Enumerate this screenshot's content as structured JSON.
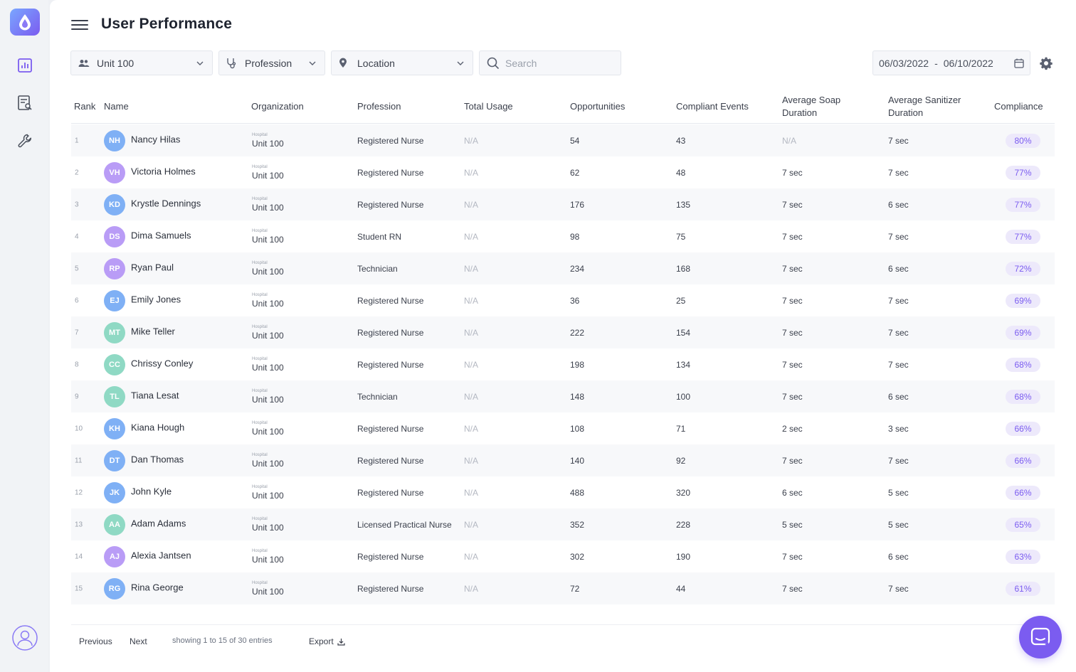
{
  "page": {
    "title": "User Performance"
  },
  "filters": {
    "unit": "Unit 100",
    "profession": "Profession",
    "location": "Location",
    "search_placeholder": "Search",
    "date_start": "06/03/2022",
    "date_sep": "-",
    "date_end": "06/10/2022"
  },
  "columns": {
    "rank": "Rank",
    "name": "Name",
    "organization": "Organization",
    "profession": "Profession",
    "total_usage": "Total Usage",
    "opportunities": "Opportunities",
    "compliant_events": "Compliant Events",
    "avg_soap_1": "Average Soap",
    "avg_soap_2": "Duration",
    "avg_sanitizer_1": "Average Sanitizer",
    "avg_sanitizer_2": "Duration",
    "compliance": "Compliance"
  },
  "rows": [
    {
      "rank": "1",
      "initials": "NH",
      "color": "#7fb0f5",
      "name": "Nancy Hilas",
      "org_label": "Hospital",
      "org": "Unit 100",
      "profession": "Registered Nurse",
      "usage": "N/A",
      "opportunities": "54",
      "compliant": "43",
      "soap": "N/A",
      "sanitizer": "7 sec",
      "compliance": "80%"
    },
    {
      "rank": "2",
      "initials": "VH",
      "color": "#b99cf6",
      "name": "Victoria Holmes",
      "org_label": "Hospital",
      "org": "Unit 100",
      "profession": "Registered Nurse",
      "usage": "N/A",
      "opportunities": "62",
      "compliant": "48",
      "soap": "7 sec",
      "sanitizer": "7 sec",
      "compliance": "77%"
    },
    {
      "rank": "3",
      "initials": "KD",
      "color": "#7fb0f5",
      "name": "Krystle Dennings",
      "org_label": "Hospital",
      "org": "Unit 100",
      "profession": "Registered Nurse",
      "usage": "N/A",
      "opportunities": "176",
      "compliant": "135",
      "soap": "7 sec",
      "sanitizer": "6 sec",
      "compliance": "77%"
    },
    {
      "rank": "4",
      "initials": "DS",
      "color": "#b99cf6",
      "name": "Dima Samuels",
      "org_label": "Hospital",
      "org": "Unit 100",
      "profession": "Student RN",
      "usage": "N/A",
      "opportunities": "98",
      "compliant": "75",
      "soap": "7 sec",
      "sanitizer": "7 sec",
      "compliance": "77%"
    },
    {
      "rank": "5",
      "initials": "RP",
      "color": "#b99cf6",
      "name": "Ryan Paul",
      "org_label": "Hospital",
      "org": "Unit 100",
      "profession": "Technician",
      "usage": "N/A",
      "opportunities": "234",
      "compliant": "168",
      "soap": "7 sec",
      "sanitizer": "6 sec",
      "compliance": "72%"
    },
    {
      "rank": "6",
      "initials": "EJ",
      "color": "#7fb0f5",
      "name": "Emily Jones",
      "org_label": "Hospital",
      "org": "Unit 100",
      "profession": "Registered Nurse",
      "usage": "N/A",
      "opportunities": "36",
      "compliant": "25",
      "soap": "7 sec",
      "sanitizer": "7 sec",
      "compliance": "69%"
    },
    {
      "rank": "7",
      "initials": "MT",
      "color": "#8fd9c4",
      "name": "Mike Teller",
      "org_label": "Hospital",
      "org": "Unit 100",
      "profession": "Registered Nurse",
      "usage": "N/A",
      "opportunities": "222",
      "compliant": "154",
      "soap": "7 sec",
      "sanitizer": "7 sec",
      "compliance": "69%"
    },
    {
      "rank": "8",
      "initials": "CC",
      "color": "#8fd9c4",
      "name": "Chrissy Conley",
      "org_label": "Hospital",
      "org": "Unit 100",
      "profession": "Registered Nurse",
      "usage": "N/A",
      "opportunities": "198",
      "compliant": "134",
      "soap": "7 sec",
      "sanitizer": "7 sec",
      "compliance": "68%"
    },
    {
      "rank": "9",
      "initials": "TL",
      "color": "#8fd9c4",
      "name": "Tiana Lesat",
      "org_label": "Hospital",
      "org": "Unit 100",
      "profession": "Technician",
      "usage": "N/A",
      "opportunities": "148",
      "compliant": "100",
      "soap": "7 sec",
      "sanitizer": "6 sec",
      "compliance": "68%"
    },
    {
      "rank": "10",
      "initials": "KH",
      "color": "#7fb0f5",
      "name": "Kiana Hough",
      "org_label": "Hospital",
      "org": "Unit 100",
      "profession": "Registered Nurse",
      "usage": "N/A",
      "opportunities": "108",
      "compliant": "71",
      "soap": "2 sec",
      "sanitizer": "3 sec",
      "compliance": "66%"
    },
    {
      "rank": "11",
      "initials": "DT",
      "color": "#7fb0f5",
      "name": "Dan Thomas",
      "org_label": "Hospital",
      "org": "Unit 100",
      "profession": "Registered Nurse",
      "usage": "N/A",
      "opportunities": "140",
      "compliant": "92",
      "soap": "7 sec",
      "sanitizer": "7 sec",
      "compliance": "66%"
    },
    {
      "rank": "12",
      "initials": "JK",
      "color": "#7fb0f5",
      "name": "John Kyle",
      "org_label": "Hospital",
      "org": "Unit 100",
      "profession": "Registered Nurse",
      "usage": "N/A",
      "opportunities": "488",
      "compliant": "320",
      "soap": "6 sec",
      "sanitizer": "5 sec",
      "compliance": "66%"
    },
    {
      "rank": "13",
      "initials": "AA",
      "color": "#8fd9c4",
      "name": "Adam Adams",
      "org_label": "Hospital",
      "org": "Unit 100",
      "profession": "Licensed Practical Nurse",
      "usage": "N/A",
      "opportunities": "352",
      "compliant": "228",
      "soap": "5 sec",
      "sanitizer": "5 sec",
      "compliance": "65%"
    },
    {
      "rank": "14",
      "initials": "AJ",
      "color": "#b99cf6",
      "name": "Alexia Jantsen",
      "org_label": "Hospital",
      "org": "Unit 100",
      "profession": "Registered Nurse",
      "usage": "N/A",
      "opportunities": "302",
      "compliant": "190",
      "soap": "7 sec",
      "sanitizer": "6 sec",
      "compliance": "63%"
    },
    {
      "rank": "15",
      "initials": "RG",
      "color": "#7fb0f5",
      "name": "Rina George",
      "org_label": "Hospital",
      "org": "Unit 100",
      "profession": "Registered Nurse",
      "usage": "N/A",
      "opportunities": "72",
      "compliant": "44",
      "soap": "7 sec",
      "sanitizer": "7 sec",
      "compliance": "61%"
    }
  ],
  "footer": {
    "previous": "Previous",
    "next": "Next",
    "info": "showing 1 to 15 of 30 entries",
    "export": "Export"
  },
  "icons": {
    "logo": "water-drop-icon",
    "nav_1": "bar-chart-icon",
    "nav_2": "report-search-icon",
    "nav_3": "wrench-icon",
    "user": "user-circle-icon",
    "chat": "chat-icon"
  },
  "colors": {
    "accent": "#7b5cf0",
    "pill_bg": "#ede9fb"
  }
}
